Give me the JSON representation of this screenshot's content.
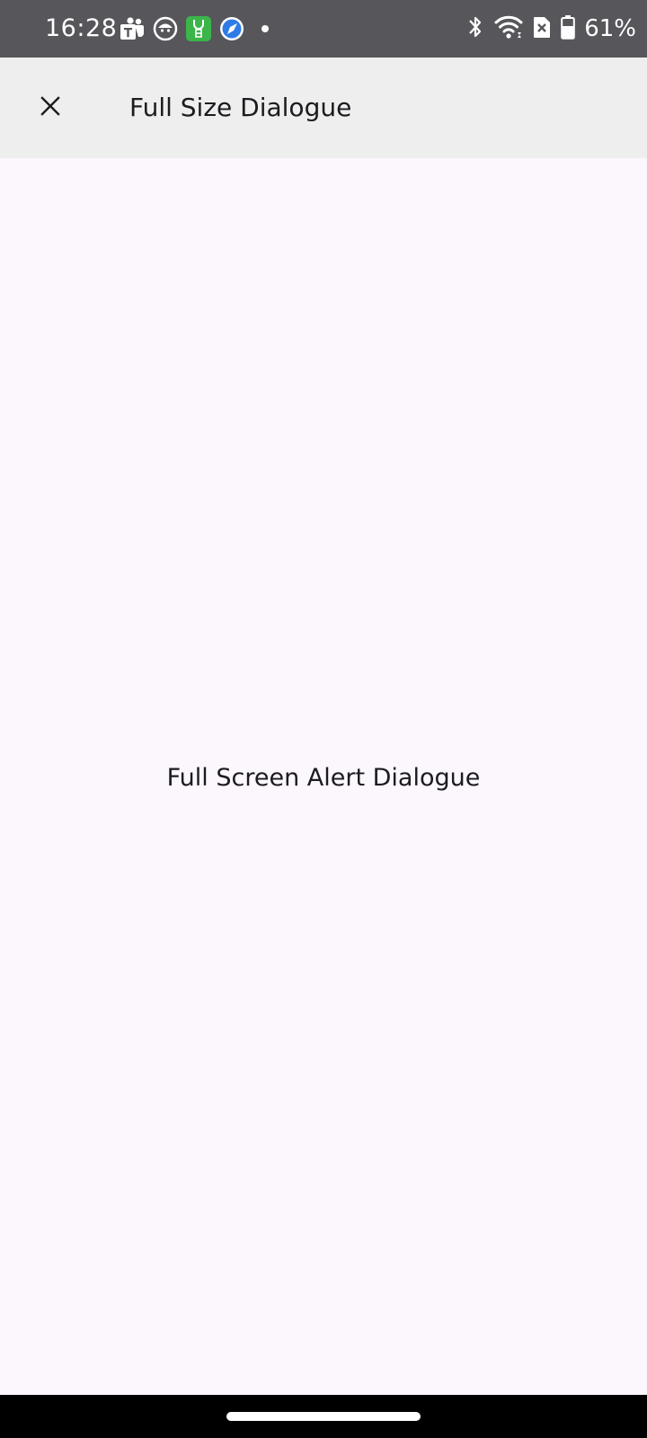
{
  "status_bar": {
    "time": "16:28",
    "battery_percent": "61%",
    "notification_icons": [
      "teams-icon",
      "face-app-icon",
      "green-app-icon",
      "blue-compass-app-icon",
      "more-dot-icon"
    ],
    "system_icons": [
      "bluetooth-icon",
      "wifi-icon",
      "no-sim-icon",
      "battery-icon"
    ],
    "background": "#57565B"
  },
  "app_bar": {
    "title": "Full Size Dialogue",
    "close_icon": "close-icon",
    "background": "#EEEEEE"
  },
  "content": {
    "message": "Full Screen Alert Dialogue",
    "background": "#FCF6FD"
  },
  "nav_bar": {
    "background": "#000000"
  }
}
